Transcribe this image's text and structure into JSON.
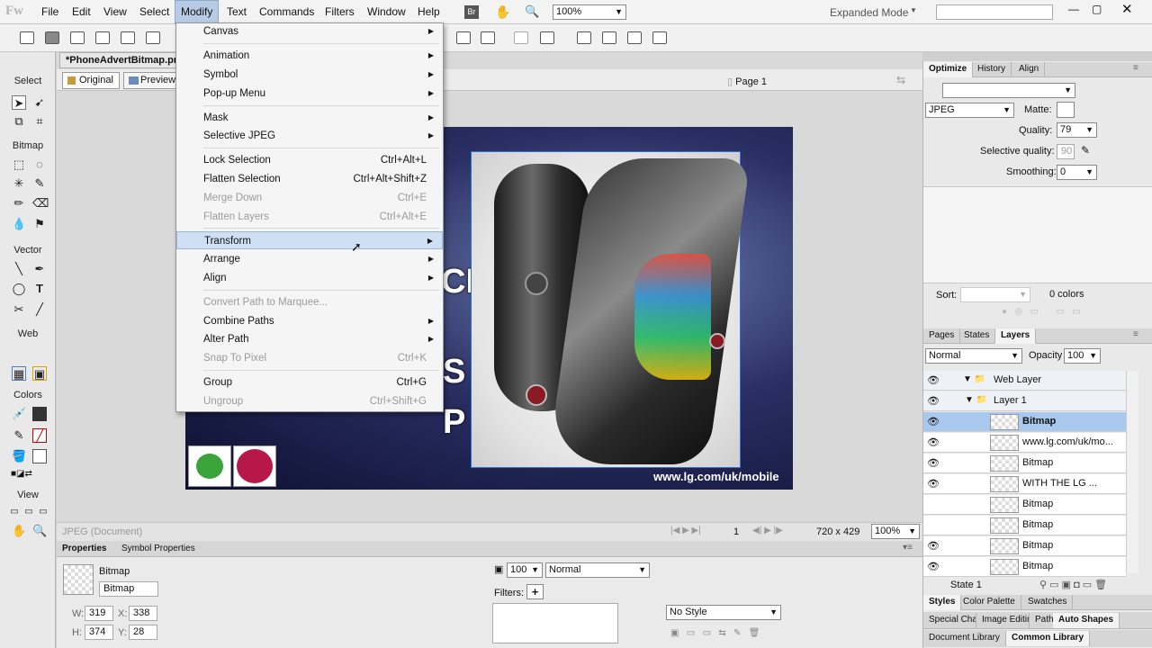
{
  "app": {
    "logo": "Fw"
  },
  "menubar": [
    "File",
    "Edit",
    "View",
    "Select",
    "Modify",
    "Text",
    "Commands",
    "Filters",
    "Window",
    "Help"
  ],
  "toolbar": {
    "zoom": "100%",
    "workspace": "Expanded Mode",
    "br": "Br"
  },
  "document": {
    "tab": "*PhoneAdvertBitmap.pn",
    "original": "Original",
    "preview": "Preview",
    "page": "Page 1"
  },
  "artwork": {
    "text1": "CK",
    "text2": "S A",
    "text3": "P",
    "url": "www.lg.com/uk/mobile"
  },
  "status": {
    "type": "JPEG (Document)",
    "page": "1",
    "size": "720 x 429",
    "zoom": "100%"
  },
  "tools": {
    "sections": [
      "Select",
      "Bitmap",
      "Vector",
      "Web",
      "Colors",
      "View"
    ]
  },
  "modify_menu": [
    {
      "label": "Canvas",
      "sub": true
    },
    {
      "label": "Animation",
      "sub": true
    },
    {
      "label": "Symbol",
      "sub": true
    },
    {
      "label": "Pop-up Menu",
      "sub": true
    },
    {
      "label": "Mask",
      "sub": true
    },
    {
      "label": "Selective JPEG",
      "sub": true
    },
    {
      "label": "Lock Selection",
      "shortcut": "Ctrl+Alt+L"
    },
    {
      "label": "Flatten Selection",
      "shortcut": "Ctrl+Alt+Shift+Z"
    },
    {
      "label": "Merge Down",
      "shortcut": "Ctrl+E",
      "disabled": true
    },
    {
      "label": "Flatten Layers",
      "shortcut": "Ctrl+Alt+E",
      "disabled": true
    },
    {
      "label": "Transform",
      "sub": true,
      "highlight": true
    },
    {
      "label": "Arrange",
      "sub": true
    },
    {
      "label": "Align",
      "sub": true
    },
    {
      "label": "Convert Path to Marquee...",
      "disabled": true
    },
    {
      "label": "Combine Paths",
      "sub": true
    },
    {
      "label": "Alter Path",
      "sub": true
    },
    {
      "label": "Snap To Pixel",
      "shortcut": "Ctrl+K",
      "disabled": true
    },
    {
      "label": "Group",
      "shortcut": "Ctrl+G"
    },
    {
      "label": "Ungroup",
      "shortcut": "Ctrl+Shift+G",
      "disabled": true
    }
  ],
  "properties": {
    "tabs": [
      "Properties",
      "Symbol Properties"
    ],
    "kind": "Bitmap",
    "name": "Bitmap",
    "w": "319",
    "h": "374",
    "x": "338",
    "y": "28",
    "opacity": "100",
    "blend": "Normal",
    "filters": "Filters:",
    "style": "No Style"
  },
  "optimize": {
    "tabs": [
      "Optimize",
      "History",
      "Align"
    ],
    "format": "JPEG",
    "matte": "Matte:",
    "quality_label": "Quality:",
    "quality": "79",
    "selq_label": "Selective quality:",
    "selq": "90",
    "smooth_label": "Smoothing:",
    "smooth": "0",
    "sort": "Sort:",
    "colors": "0 colors"
  },
  "layers": {
    "tabs": [
      "Pages",
      "States",
      "Layers"
    ],
    "blend": "Normal",
    "opacity_label": "Opacity",
    "opacity": "100",
    "state": "State 1",
    "rows": [
      {
        "name": "Web Layer",
        "type": "folder"
      },
      {
        "name": "Layer 1",
        "type": "folder"
      },
      {
        "name": "Bitmap",
        "selected": true
      },
      {
        "name": "www.lg.com/uk/mo..."
      },
      {
        "name": "Bitmap"
      },
      {
        "name": "WITH THE  LG ..."
      },
      {
        "name": "Bitmap"
      },
      {
        "name": "Bitmap"
      },
      {
        "name": "Bitmap"
      },
      {
        "name": "Bitmap"
      }
    ]
  },
  "bottom_tabs": {
    "row1": [
      "Styles",
      "Color Palette",
      "Swatches"
    ],
    "row2": [
      "Special Char",
      "Image Editin",
      "Path",
      "Auto Shapes"
    ],
    "row3": [
      "Document Library",
      "Common Library"
    ]
  }
}
